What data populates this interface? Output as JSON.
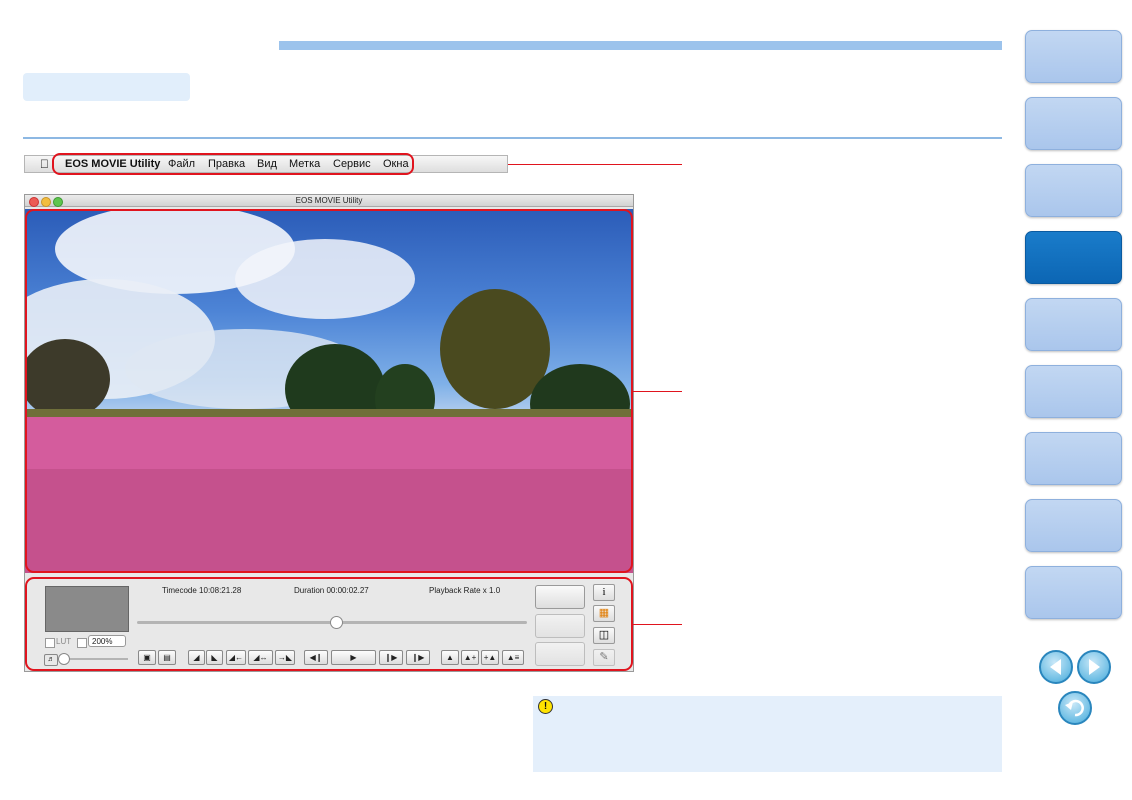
{
  "menubar": {
    "apple": "",
    "items": [
      "EOS MOVIE Utility",
      "Файл",
      "Правка",
      "Вид",
      "Метка",
      "Сервис",
      "Окна"
    ]
  },
  "window": {
    "title": "EOS MOVIE Utility"
  },
  "controls": {
    "timecode": "Timecode 10:08:21.28",
    "duration": "Duration 00:00:02.27",
    "playback_rate": "Playback Rate x 1.0",
    "lut_label": "LUT",
    "zoom_value": "200%",
    "info_label": "i"
  },
  "side_tabs": {
    "count": 9,
    "active_index": 3
  },
  "colors": {
    "callout": "#e0141e",
    "accent_blue": "#0c66b4",
    "caution_bg": "#e4effb"
  }
}
